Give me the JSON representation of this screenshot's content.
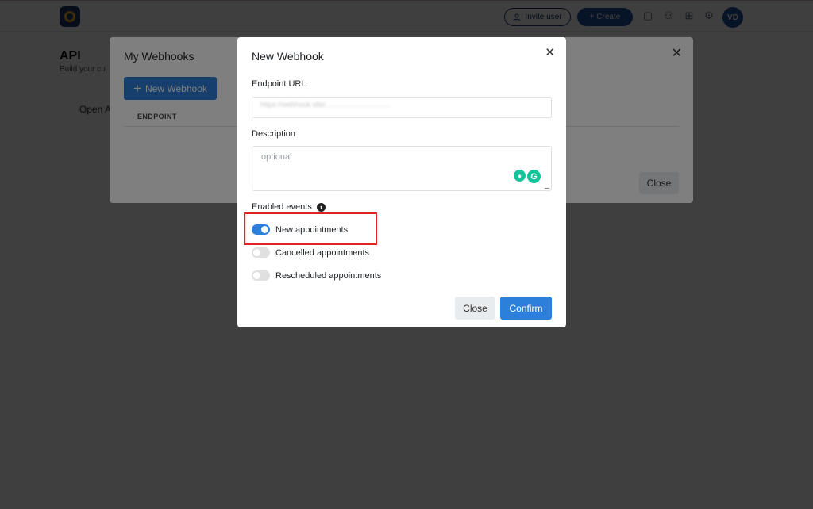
{
  "topbar": {
    "invite_label": "Invite user",
    "create_label": "+ Create",
    "avatar_initials": "VD"
  },
  "page": {
    "title": "API",
    "subtitle": "Build your cu",
    "card_text": "Open A"
  },
  "webhooks_panel": {
    "title": "My Webhooks",
    "new_button_label": "New Webhook",
    "column_endpoint": "ENDPOINT",
    "close_label": "Close"
  },
  "modal": {
    "title": "New Webhook",
    "endpoint_label": "Endpoint URL",
    "endpoint_value": "https://webhook.site/.................................",
    "description_label": "Description",
    "description_placeholder": "optional",
    "enabled_events_label": "Enabled events",
    "events": [
      {
        "label": "New appointments",
        "enabled": true
      },
      {
        "label": "Cancelled appointments",
        "enabled": false
      },
      {
        "label": "Rescheduled appointments",
        "enabled": false
      }
    ],
    "close_label": "Close",
    "confirm_label": "Confirm"
  },
  "colors": {
    "primary": "#2d7fdc",
    "navy": "#1f3a6b",
    "highlight": "#e02424",
    "grammarly": "#15c39a"
  }
}
